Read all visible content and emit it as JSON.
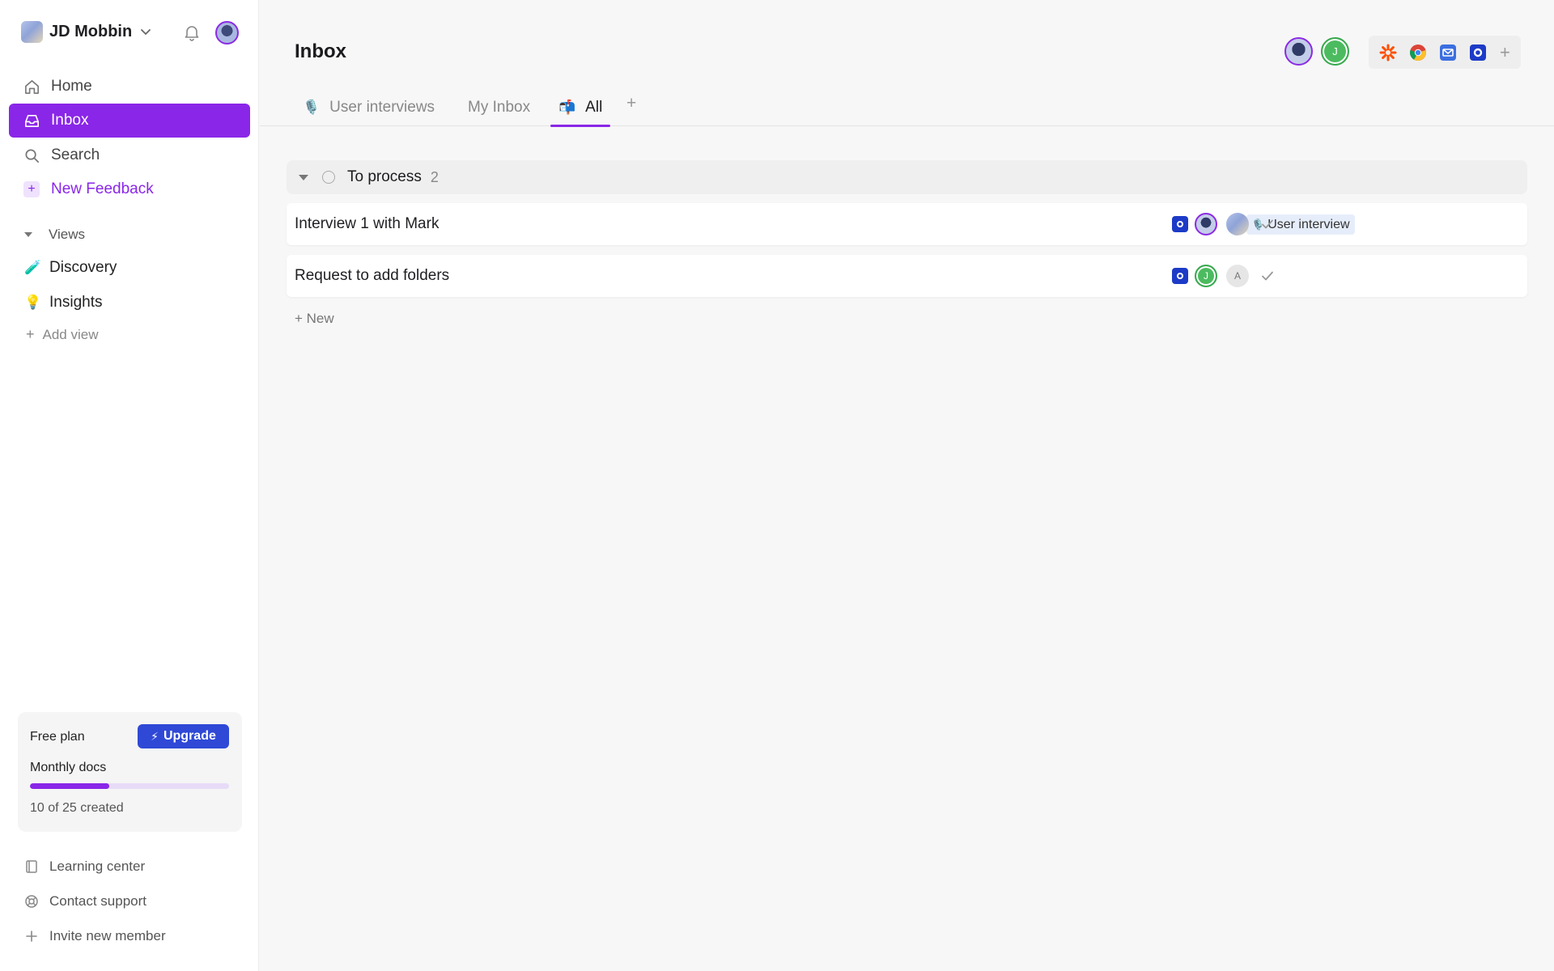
{
  "workspace": {
    "name": "JD Mobbin"
  },
  "sidebar": {
    "nav": [
      {
        "label": "Home"
      },
      {
        "label": "Inbox"
      },
      {
        "label": "Search"
      },
      {
        "label": "New Feedback"
      }
    ],
    "views_heading": "Views",
    "views": [
      {
        "label": "Discovery",
        "icon": "🧪"
      },
      {
        "label": "Insights",
        "icon": "💡"
      }
    ],
    "add_view": "Add view",
    "plan": {
      "name": "Free plan",
      "upgrade_label": "Upgrade",
      "quota_label": "Monthly docs",
      "used": 10,
      "total": 25,
      "count_text": "10 of 25 created"
    },
    "footer": [
      {
        "label": "Learning center"
      },
      {
        "label": "Contact support"
      },
      {
        "label": "Invite new member"
      }
    ]
  },
  "main": {
    "title": "Inbox",
    "header_avatar_initial": "J",
    "tabs": [
      {
        "label": "User interviews",
        "icon": "🎙️"
      },
      {
        "label": "My Inbox",
        "icon": ""
      },
      {
        "label": "All",
        "icon": "📬",
        "active": true
      }
    ],
    "group": {
      "label": "To process",
      "count": "2"
    },
    "rows": [
      {
        "title": "Interview 1 with Mark",
        "tag": "User interview",
        "tag_icon": "🎙️"
      },
      {
        "title": "Request to add folders",
        "initial_a": "J",
        "initial_b": "A"
      }
    ],
    "new_label": "+ New"
  },
  "colors": {
    "accent": "#8a26e8",
    "upgrade": "#2f49d6",
    "green": "#4cbb5f"
  }
}
